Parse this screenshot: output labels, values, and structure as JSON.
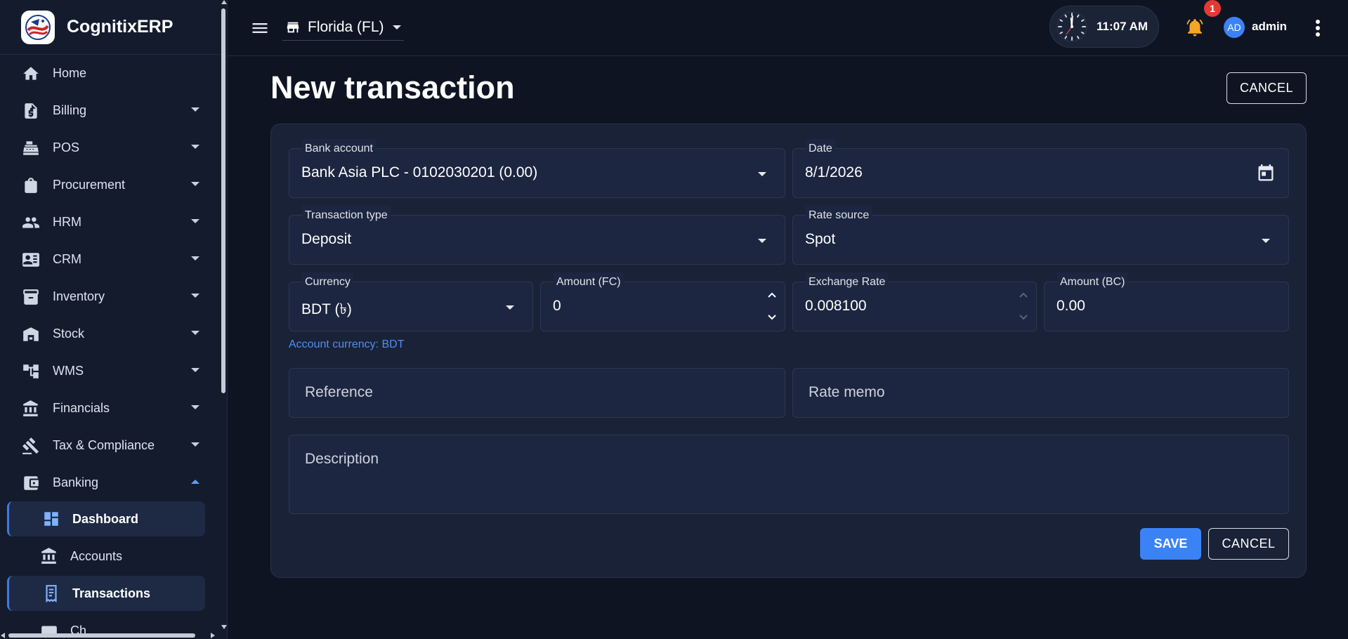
{
  "app": {
    "name": "CognitixERP"
  },
  "sidebar": {
    "items": [
      {
        "label": "Home",
        "icon": "home-icon",
        "expandable": false
      },
      {
        "label": "Billing",
        "icon": "invoice-dollar-icon",
        "expandable": true
      },
      {
        "label": "POS",
        "icon": "cash-register-icon",
        "expandable": true
      },
      {
        "label": "Procurement",
        "icon": "shopping-bag-icon",
        "expandable": true
      },
      {
        "label": "HRM",
        "icon": "people-icon",
        "expandable": true
      },
      {
        "label": "CRM",
        "icon": "contact-card-icon",
        "expandable": true
      },
      {
        "label": "Inventory",
        "icon": "archive-box-icon",
        "expandable": true
      },
      {
        "label": "Stock",
        "icon": "warehouse-icon",
        "expandable": true
      },
      {
        "label": "WMS",
        "icon": "hierarchy-icon",
        "expandable": true
      },
      {
        "label": "Financials",
        "icon": "bank-building-icon",
        "expandable": true
      },
      {
        "label": "Tax & Compliance",
        "icon": "gavel-icon",
        "expandable": true
      },
      {
        "label": "Banking",
        "icon": "wallet-icon",
        "expandable": true,
        "expanded": true
      }
    ],
    "banking_children": [
      {
        "label": "Dashboard",
        "icon": "dashboard-icon",
        "active": true
      },
      {
        "label": "Accounts",
        "icon": "bank-building-icon",
        "active": false
      },
      {
        "label": "Transactions",
        "icon": "receipt-icon",
        "active": true
      },
      {
        "label": "Ch...",
        "icon": "cheque-icon",
        "active": false
      }
    ]
  },
  "topbar": {
    "store": "Florida (FL)",
    "time": "11:07 AM",
    "notification_count": "1",
    "avatar_initials": "AD",
    "user": "admin"
  },
  "page": {
    "title": "New transaction",
    "cancel_top": "CANCEL"
  },
  "form": {
    "bank_account": {
      "label": "Bank account",
      "value": "Bank Asia PLC - 0102030201 (0.00)"
    },
    "date": {
      "label": "Date",
      "value": "8/1/2026"
    },
    "transaction_type": {
      "label": "Transaction type",
      "value": "Deposit"
    },
    "rate_source": {
      "label": "Rate source",
      "value": "Spot"
    },
    "currency": {
      "label": "Currency",
      "value": "BDT (৳)"
    },
    "amount_fc": {
      "label": "Amount (FC)",
      "value": "0"
    },
    "exchange_rate": {
      "label": "Exchange Rate",
      "value": "0.008100"
    },
    "amount_bc": {
      "label": "Amount (BC)",
      "value": "0.00"
    },
    "account_currency_helper": "Account currency: BDT",
    "reference": {
      "placeholder": "Reference"
    },
    "rate_memo": {
      "placeholder": "Rate memo"
    },
    "description": {
      "placeholder": "Description"
    },
    "save_label": "SAVE",
    "cancel_label": "CANCEL"
  },
  "colors": {
    "background": "#0f1422",
    "sidebar": "#141b2d",
    "card": "#1a2238",
    "accent": "#3b82f6",
    "badge": "#e53935",
    "bell": "#f5a623"
  }
}
